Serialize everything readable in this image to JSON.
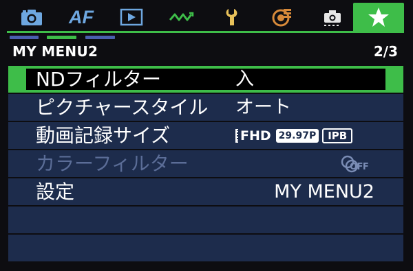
{
  "tabs": [
    {
      "name": "camera-icon",
      "label": "Camera settings"
    },
    {
      "name": "af-tab",
      "label": "AF"
    },
    {
      "name": "playback-icon",
      "label": "Playback"
    },
    {
      "name": "wireless-icon",
      "label": "Wireless"
    },
    {
      "name": "wrench-icon",
      "label": "Setup"
    },
    {
      "name": "custom-function-icon",
      "label": "Custom functions"
    },
    {
      "name": "camera-settings-icon",
      "label": "Camera"
    },
    {
      "name": "star-icon",
      "label": "My Menu",
      "active": true
    }
  ],
  "af_label": "AF",
  "header": {
    "title": "MY MENU2",
    "page": "2/3"
  },
  "menu": {
    "items": [
      {
        "label": "NDフィルター",
        "value": "入",
        "selected": true,
        "enabled": true
      },
      {
        "label": "ピクチャースタイル",
        "value": "オート",
        "selected": false,
        "enabled": true
      },
      {
        "label": "動画記録サイズ",
        "value_fhd": "FHD",
        "value_fps": "29.97P",
        "value_comp": "IPB",
        "selected": false,
        "enabled": true
      },
      {
        "label": "カラーフィルター",
        "value_off": "OFF",
        "selected": false,
        "enabled": false
      },
      {
        "label": "設定",
        "value": "MY MENU2",
        "selected": false,
        "enabled": true
      }
    ]
  },
  "colors": {
    "accent": "#3ebd49",
    "row_bg": "#1d2c4c",
    "dim_text": "#5b6d97",
    "page_indicator_inactive": "#4a5fae"
  }
}
